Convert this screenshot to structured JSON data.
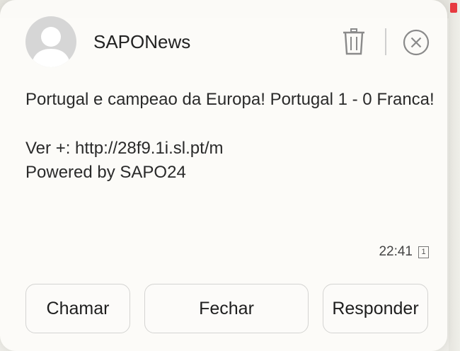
{
  "notification": {
    "sender": "SAPONews",
    "message_line1": "Portugal e campeao da Europa! Portugal 1 - 0 Franca!",
    "link_line": "Ver +: http://28f9.1i.sl.pt/m",
    "powered_line": "Powered by SAPO24",
    "time": "22:41",
    "count": "1"
  },
  "icons": {
    "avatar": "person-placeholder-icon",
    "delete": "trash-icon",
    "close": "close-circle-icon"
  },
  "actions": {
    "call_label": "Chamar",
    "close_label": "Fechar",
    "reply_label": "Responder"
  },
  "colors": {
    "background": "#fcfbf8",
    "text": "#222222",
    "icon_gray": "#8a8a8a",
    "avatar_bg": "#d6d6d6"
  }
}
